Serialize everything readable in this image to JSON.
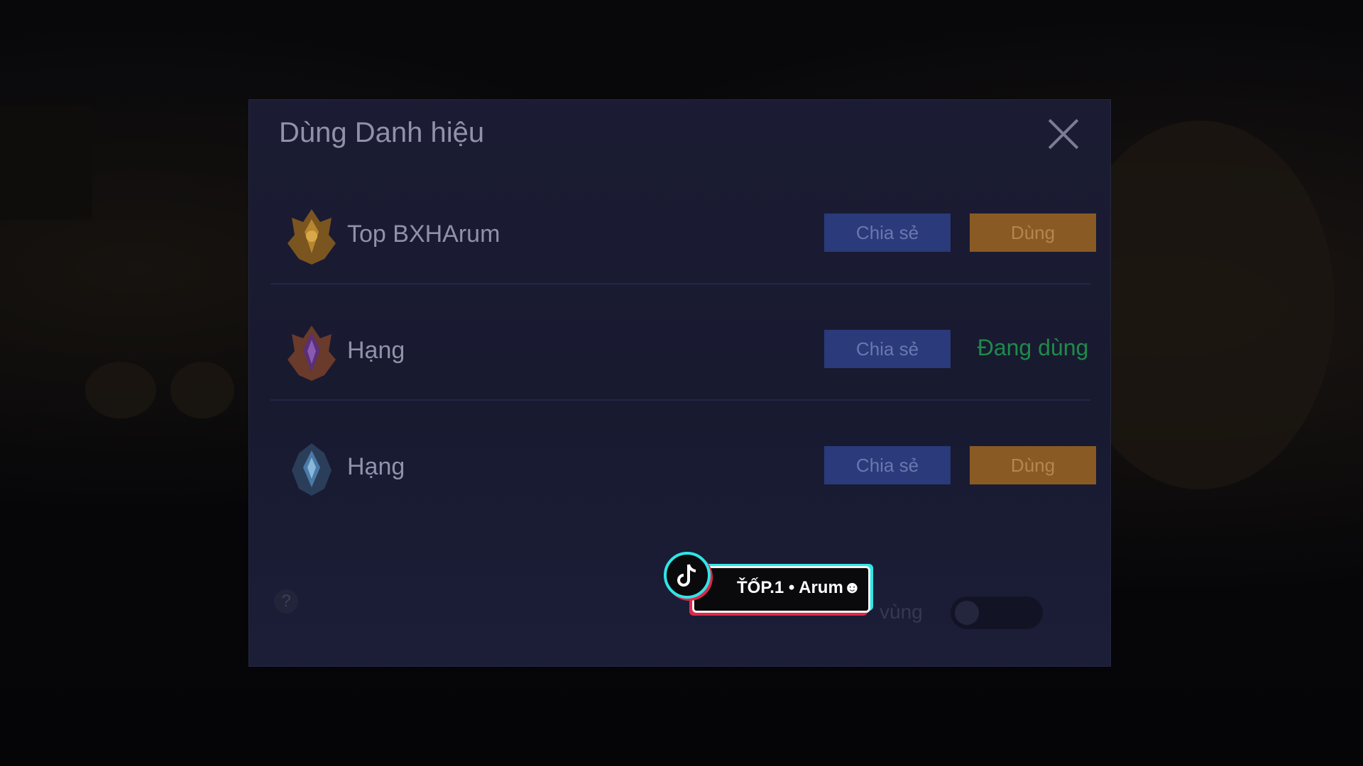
{
  "modal": {
    "title": "Dùng Danh hiệu",
    "close_icon": "close-icon"
  },
  "titles": [
    {
      "label": "Top BXHArum",
      "share_label": "Chia sẻ",
      "action_label": "Dùng",
      "state": "available",
      "icon": "gold-rank-emblem-icon"
    },
    {
      "label": "Hạng",
      "share_label": "Chia sẻ",
      "action_label": "Đang dùng",
      "state": "in-use",
      "icon": "purple-rank-emblem-icon"
    },
    {
      "label": "Hạng",
      "share_label": "Chia sẻ",
      "action_label": "Dùng",
      "state": "available",
      "icon": "blue-rank-emblem-icon"
    }
  ],
  "footer": {
    "help_icon": "?",
    "region_label": "vùng",
    "toggle_state": "off"
  },
  "watermark": {
    "text": "ŤỐP.1 • Arum☻",
    "icon": "tiktok-logo-icon"
  },
  "colors": {
    "share_button": "#2a3a7a",
    "use_button": "#8a5a24",
    "in_use_text": "#1f8a4a",
    "modal_bg": "#1b1c33"
  }
}
